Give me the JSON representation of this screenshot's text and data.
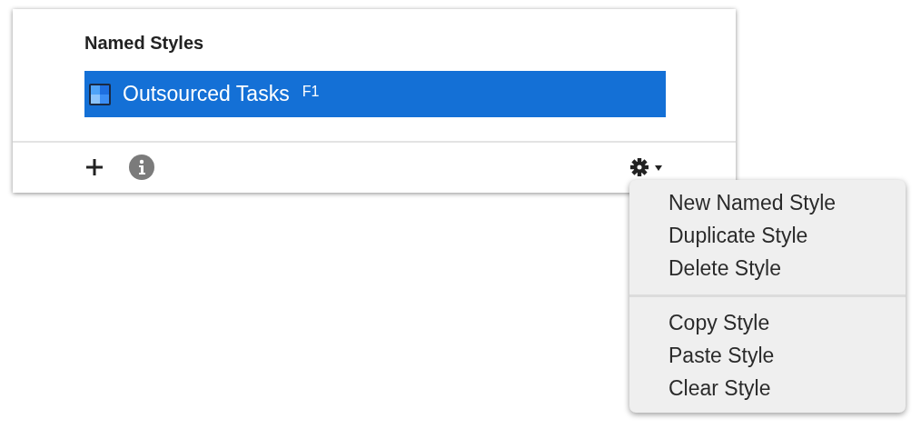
{
  "panel": {
    "title": "Named Styles",
    "styles": [
      {
        "name": "Outsourced Tasks",
        "shortcut": "F1",
        "selected": true
      }
    ]
  },
  "menu": {
    "groups": [
      [
        "New Named Style",
        "Duplicate Style",
        "Delete Style"
      ],
      [
        "Copy Style",
        "Paste Style",
        "Clear Style"
      ]
    ]
  }
}
